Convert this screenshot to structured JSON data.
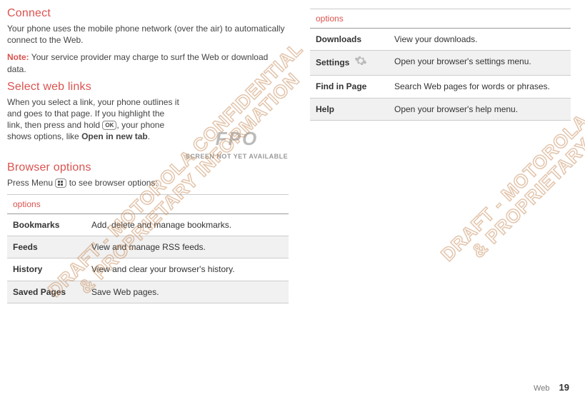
{
  "left": {
    "connect": {
      "heading": "Connect",
      "p1": "Your phone uses the mobile phone network (over the air) to automatically connect to the Web.",
      "note_label": "Note:",
      "note_text": " Your service provider may charge to surf the Web or download data."
    },
    "select": {
      "heading": "Select web links",
      "text_a": "When you select a link, your phone outlines it and goes to that page. If you highlight the link, then press and hold ",
      "key": "OK",
      "text_b": ", your phone shows options, like ",
      "bold": "Open in new tab",
      "text_c": "."
    },
    "fpo": {
      "big": "FPO",
      "small": "SCREEN NOT YET AVAILABLE"
    },
    "browser": {
      "heading": "Browser options",
      "intro_a": "Press Menu ",
      "intro_b": " to see browser options:"
    },
    "table_header": "options",
    "rows": [
      {
        "label": "Bookmarks",
        "desc": "Add, delete and manage bookmarks."
      },
      {
        "label": "Feeds",
        "desc": "View and manage RSS feeds."
      },
      {
        "label": "History",
        "desc": "View and clear your browser's history."
      },
      {
        "label": "Saved Pages",
        "desc": "Save Web pages."
      }
    ]
  },
  "right": {
    "table_header": "options",
    "rows": [
      {
        "label": "Downloads",
        "desc": "View your downloads."
      },
      {
        "label": "Settings",
        "desc": "Open your browser's settings menu."
      },
      {
        "label": "Find in Page",
        "desc": "Search Web pages for words or phrases."
      },
      {
        "label": "Help",
        "desc": "Open your browser's help menu."
      }
    ]
  },
  "watermark": {
    "line1": "DRAFT - MOTOROLA CONFIDENTIAL",
    "line2": "& PROPRIETARY INFORMATION"
  },
  "footer": {
    "section": "Web",
    "page": "19"
  }
}
